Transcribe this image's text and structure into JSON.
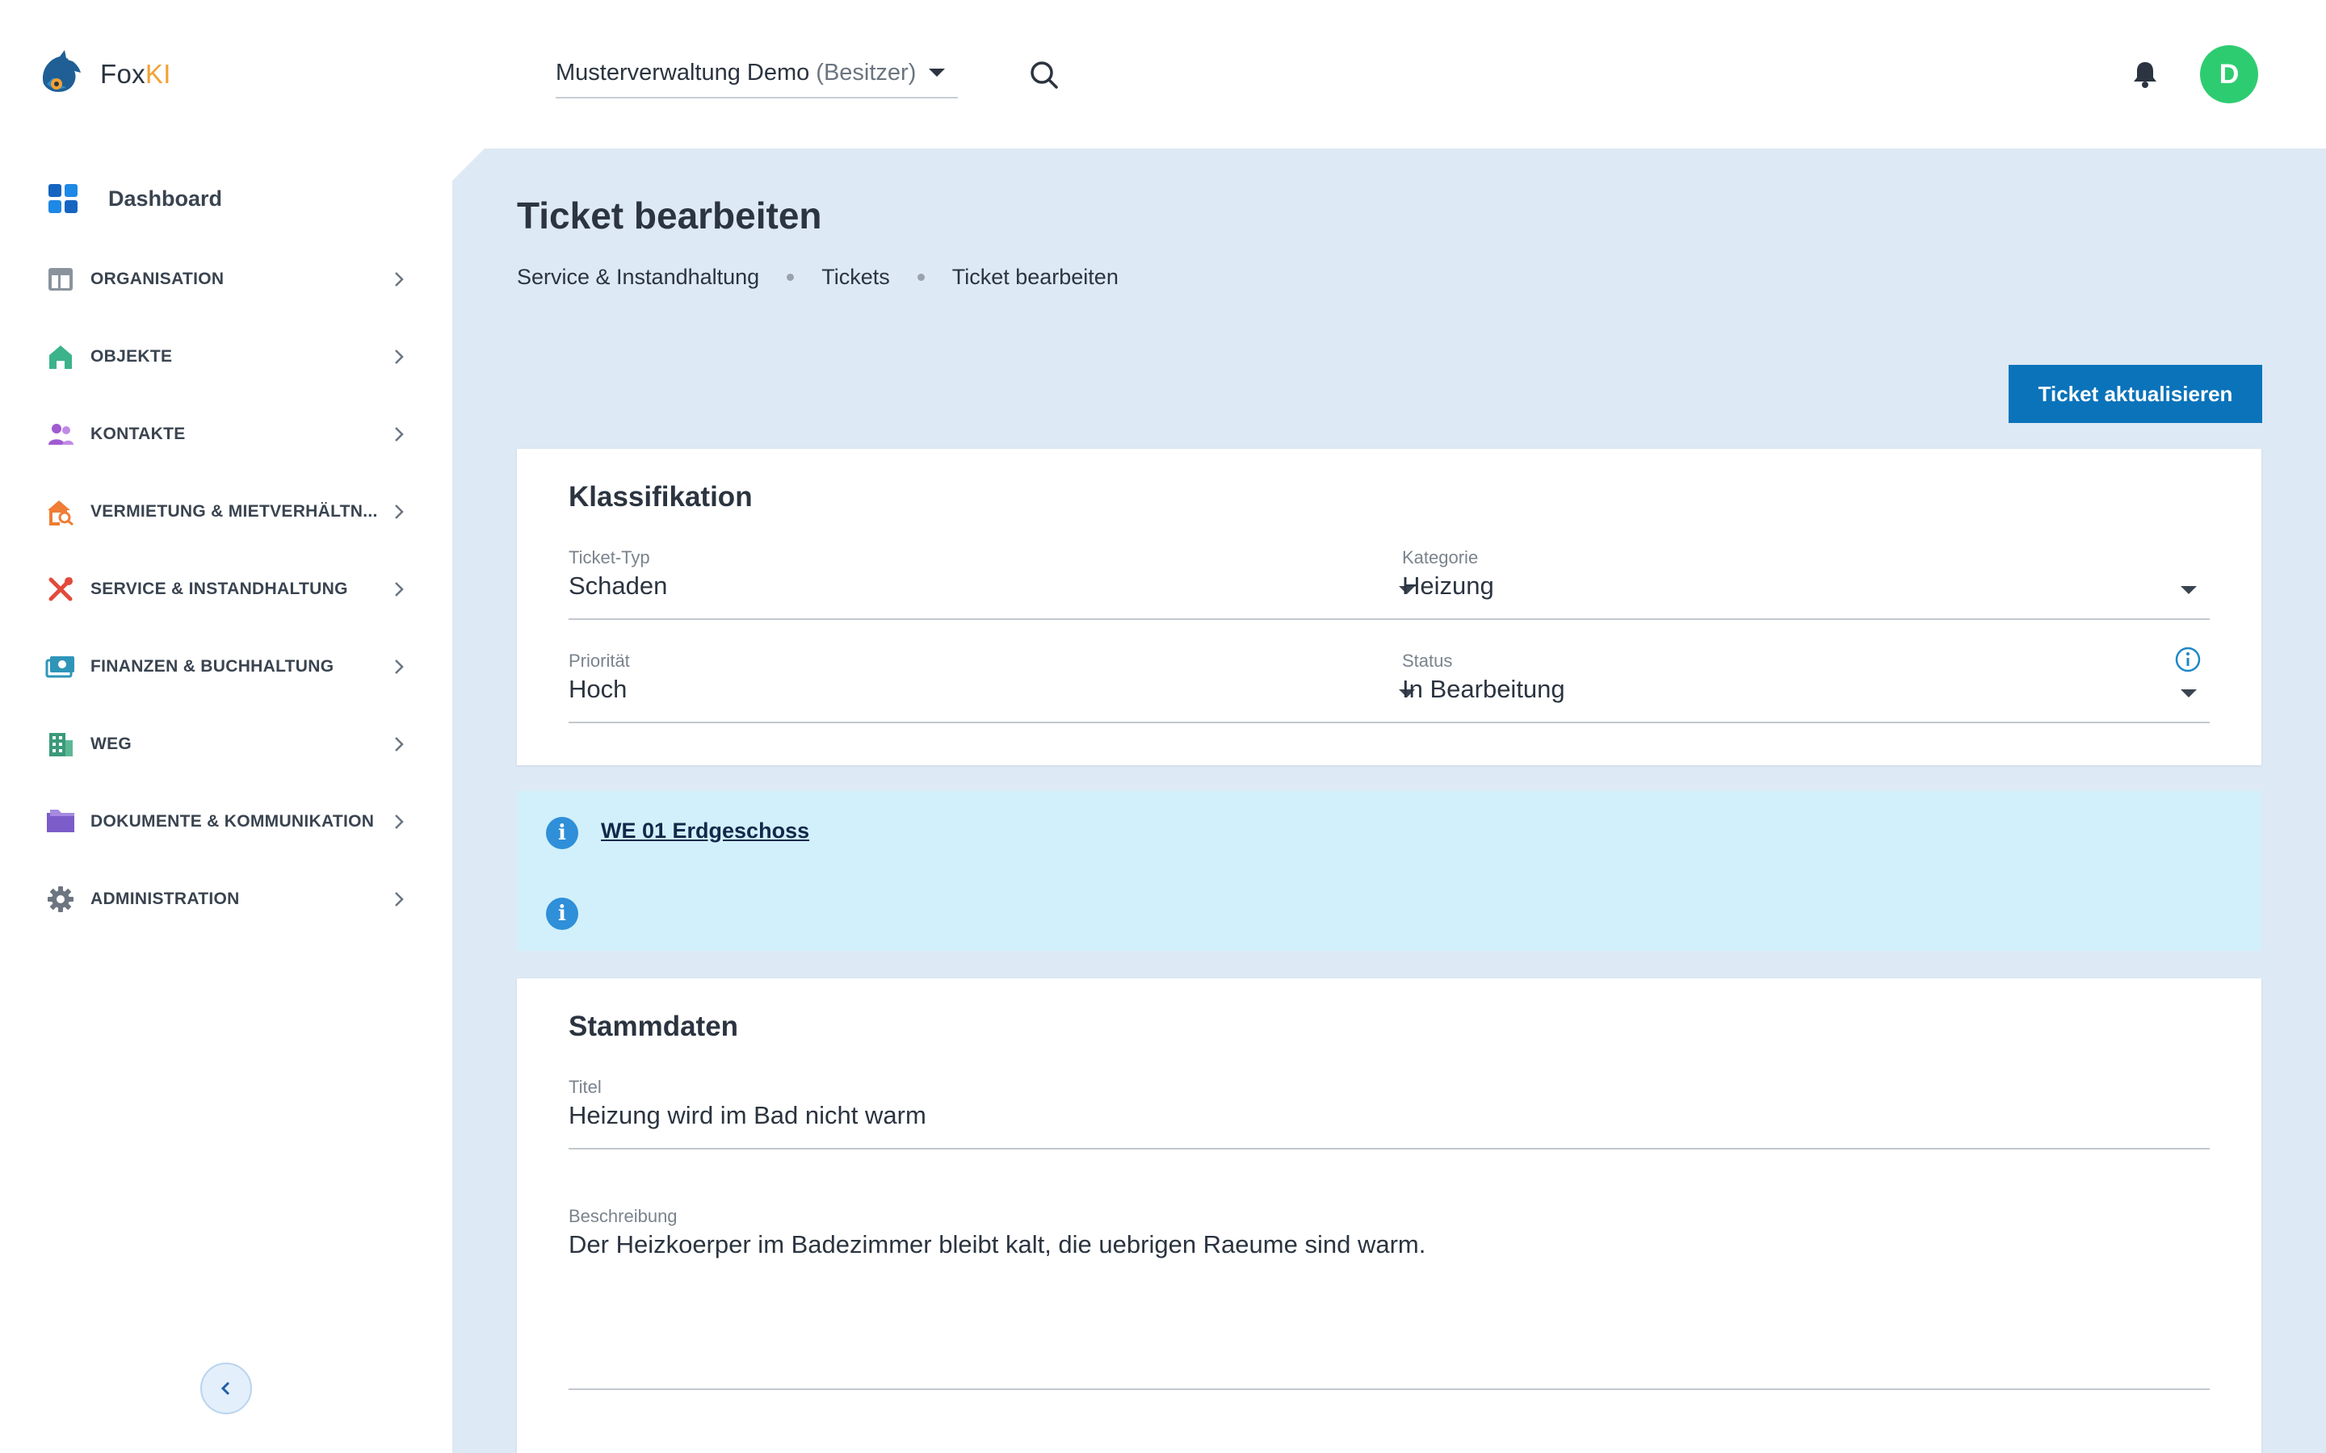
{
  "app": {
    "name_prefix": "Fox",
    "name_suffix": "KI",
    "brand_color": "#0a73ba",
    "accent_color": "#f2a233"
  },
  "header": {
    "org_name": "Musterverwaltung Demo",
    "org_role": "(Besitzer)",
    "avatar_letter": "D",
    "avatar_color": "#2ecc71"
  },
  "sidebar": {
    "dashboard_label": "Dashboard",
    "items": [
      {
        "label": "ORGANISATION",
        "icon": "layout-icon",
        "color": "#8a939d"
      },
      {
        "label": "OBJEKTE",
        "icon": "house-icon",
        "color": "#3cb38a"
      },
      {
        "label": "KONTAKTE",
        "icon": "people-icon",
        "color": "#a05bd0"
      },
      {
        "label": "VERMIETUNG & MIETVERHÄLTN...",
        "icon": "house-search-icon",
        "color": "#ef7d35"
      },
      {
        "label": "SERVICE & INSTANDHALTUNG",
        "icon": "tools-icon",
        "color": "#e24a3b"
      },
      {
        "label": "FINANZEN & BUCHHALTUNG",
        "icon": "money-icon",
        "color": "#2f95b8"
      },
      {
        "label": "WEG",
        "icon": "building-icon",
        "color": "#3a9a7a"
      },
      {
        "label": "DOKUMENTE & KOMMUNIKATION",
        "icon": "folder-icon",
        "color": "#7b5cc9"
      },
      {
        "label": "ADMINISTRATION",
        "icon": "gear-icon",
        "color": "#6d7680"
      }
    ]
  },
  "page": {
    "title": "Ticket bearbeiten",
    "breadcrumb": [
      "Service & Instandhaltung",
      "Tickets",
      "Ticket bearbeiten"
    ],
    "update_button": "Ticket aktualisieren"
  },
  "klassifikation": {
    "title": "Klassifikation",
    "ticket_typ": {
      "label": "Ticket-Typ",
      "value": "Schaden"
    },
    "kategorie": {
      "label": "Kategorie",
      "value": "Heizung"
    },
    "prioritaet": {
      "label": "Priorität",
      "value": "Hoch"
    },
    "status": {
      "label": "Status",
      "value": "In Bearbeitung"
    }
  },
  "info": {
    "unit_link": "WE 01 Erdgeschoss"
  },
  "stammdaten": {
    "title": "Stammdaten",
    "titel": {
      "label": "Titel",
      "value": "Heizung wird im Bad nicht warm"
    },
    "beschreibung": {
      "label": "Beschreibung",
      "value": "Der Heizkoerper im Badezimmer bleibt kalt, die uebrigen Raeume sind warm."
    }
  }
}
